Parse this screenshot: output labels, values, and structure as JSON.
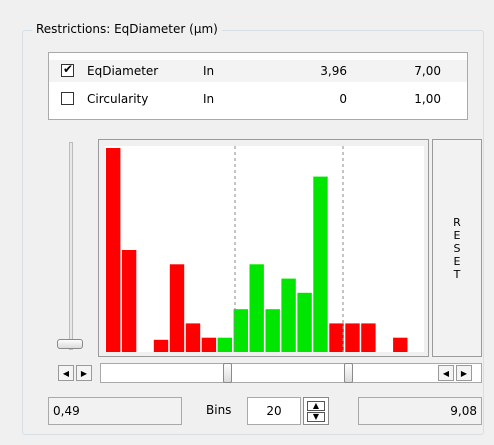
{
  "groupbox": {
    "title": "Restrictions:  EqDiameter   (µm)"
  },
  "restrictions": [
    {
      "checked": true,
      "name": "EqDiameter",
      "mode": "In",
      "min": "3,96",
      "max": "7,00"
    },
    {
      "checked": false,
      "name": "Circularity",
      "mode": "In",
      "min": "0",
      "max": "1,00"
    }
  ],
  "reset_label": "RESET",
  "histogram": {
    "values": [
      200,
      100,
      0,
      12,
      86,
      28,
      14,
      14,
      42,
      86,
      42,
      72,
      58,
      172,
      28,
      28,
      28,
      0,
      14,
      0
    ],
    "colors": [
      "red",
      "red",
      "red",
      "red",
      "red",
      "red",
      "red",
      "green",
      "green",
      "green",
      "green",
      "green",
      "green",
      "green",
      "red",
      "red",
      "red",
      "red",
      "red",
      "red"
    ],
    "color_hex": {
      "red": "#ff0000",
      "green": "#00e600"
    }
  },
  "range": {
    "min_value": "0,49",
    "max_value": "9,08"
  },
  "bins": {
    "label": "Bins",
    "value": "20"
  }
}
